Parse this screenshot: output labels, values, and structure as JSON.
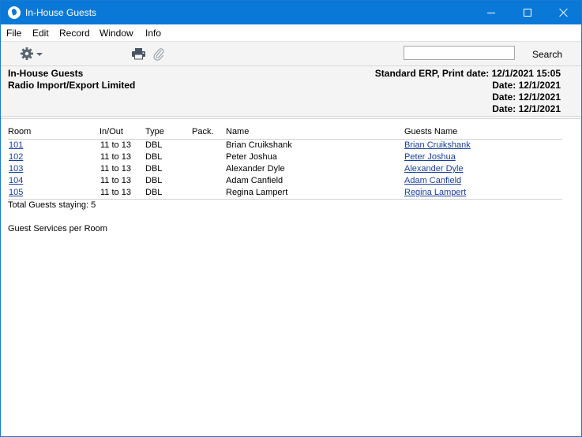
{
  "window": {
    "title": "In-House Guests"
  },
  "menu": {
    "items": [
      "File",
      "Edit",
      "Record",
      "Window",
      "Info"
    ]
  },
  "toolbar": {
    "search_value": "",
    "search_label": "Search"
  },
  "report": {
    "title": "In-House Guests",
    "company": "Radio Import/Export Limited",
    "print_line": "Standard ERP, Print date: 12/1/2021 15:05",
    "date_lines": [
      "Date: 12/1/2021",
      "Date: 12/1/2021",
      "Date: 12/1/2021"
    ]
  },
  "table": {
    "columns": [
      "Room",
      "In/Out",
      "Type",
      "Pack.",
      "Name",
      "Guests Name"
    ],
    "rows": [
      {
        "room": "101",
        "inout": "11 to 13",
        "type": "DBL",
        "pack": "",
        "name": "Brian Cruikshank",
        "guest": "Brian Cruikshank"
      },
      {
        "room": "102",
        "inout": "11 to 13",
        "type": "DBL",
        "pack": "",
        "name": "Peter Joshua",
        "guest": "Peter Joshua"
      },
      {
        "room": "103",
        "inout": "11 to 13",
        "type": "DBL",
        "pack": "",
        "name": "Alexander Dyle",
        "guest": "Alexander Dyle"
      },
      {
        "room": "104",
        "inout": "11 to 13",
        "type": "DBL",
        "pack": "",
        "name": "Adam Canfield",
        "guest": "Adam Canfield"
      },
      {
        "room": "105",
        "inout": "11 to 13",
        "type": "DBL",
        "pack": "",
        "name": "Regina Lampert",
        "guest": "Regina Lampert"
      }
    ],
    "total": "Total Guests staying: 5"
  },
  "section": {
    "title": "Guest Services per Room"
  },
  "icons": {
    "app": "app-logo-icon",
    "operations": "gear-icon",
    "print": "printer-icon",
    "attach": "paperclip-icon"
  },
  "colors": {
    "titlebar": "#0a78d7",
    "link": "#1a3f99",
    "toolbar_bg": "#f4f4f4"
  }
}
